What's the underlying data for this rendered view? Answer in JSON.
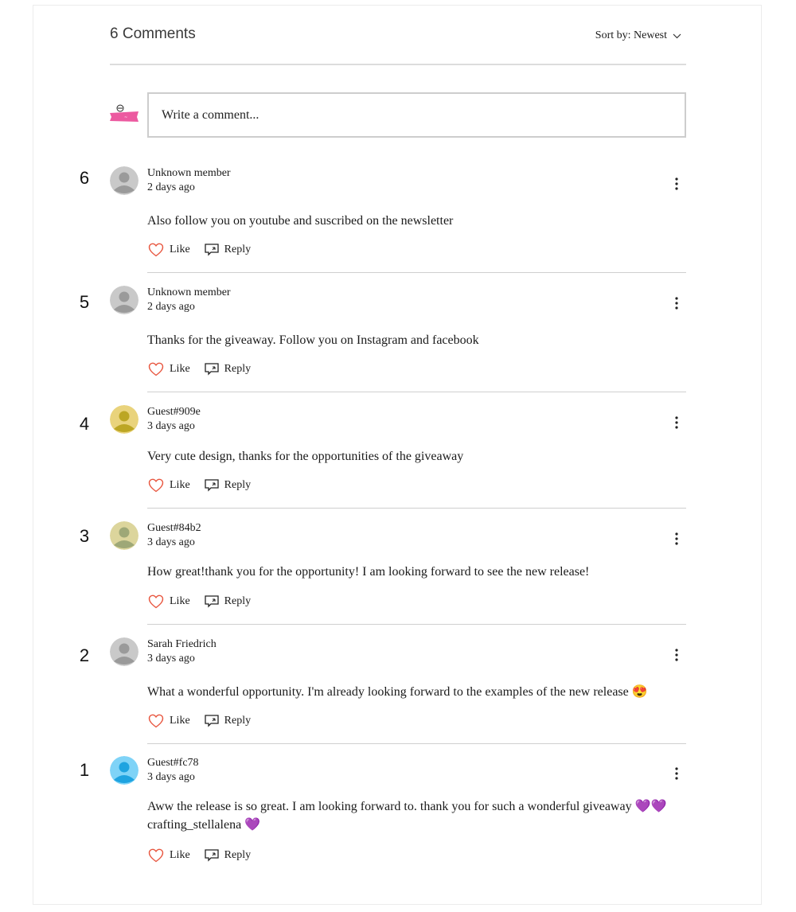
{
  "header": {
    "count_label": "6 Comments",
    "sort_label": "Sort by: Newest"
  },
  "composer": {
    "placeholder": "Write a comment..."
  },
  "actions": {
    "like": "Like",
    "reply": "Reply"
  },
  "colors": {
    "like_heart": "#e8563f",
    "divider": "#cfcfcf"
  },
  "comments": [
    {
      "number": "6",
      "author": "Unknown member",
      "time": "2 days ago",
      "text": "Also follow you on youtube and suscribed on the newsletter",
      "avatar_color": "#c9c9c9",
      "avatar_fg": "#9a9a9a"
    },
    {
      "number": "5",
      "author": "Unknown member",
      "time": "2 days ago",
      "text": "Thanks for the giveaway. Follow you on Instagram and facebook",
      "avatar_color": "#c9c9c9",
      "avatar_fg": "#9a9a9a"
    },
    {
      "number": "4",
      "author": "Guest#909e",
      "time": "3 days ago",
      "text": "Very cute design, thanks for the opportunities of the giveaway",
      "avatar_color": "#e9d37c",
      "avatar_fg": "#bca624"
    },
    {
      "number": "3",
      "author": "Guest#84b2",
      "time": "3 days ago",
      "text": "How great!thank you for the opportunity! I am looking forward to see the new release!",
      "avatar_color": "#dcd59c",
      "avatar_fg": "#9ea877"
    },
    {
      "number": "2",
      "author": "Sarah Friedrich",
      "time": "3 days ago",
      "text": "What a wonderful opportunity. I'm already looking forward to the examples of the new release 😍",
      "avatar_color": "#c9c9c9",
      "avatar_fg": "#9a9a9a"
    },
    {
      "number": "1",
      "author": "Guest#fc78",
      "time": "3 days ago",
      "text": "Aww the release is so great. I am looking forward to. thank you for such a wonderful giveaway 💜💜",
      "text_line2": "crafting_stellalena 💜",
      "avatar_color": "#7fd3f7",
      "avatar_fg": "#1ea3e0"
    }
  ]
}
